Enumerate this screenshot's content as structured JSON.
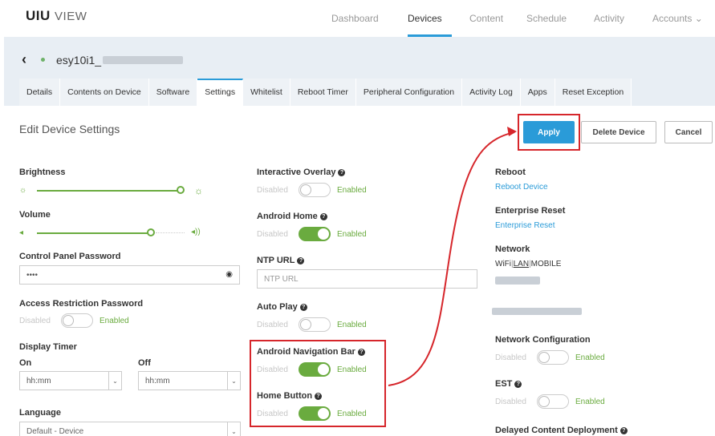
{
  "app": {
    "logo_bold": "UIU",
    "logo_light": "VIEW"
  },
  "nav": [
    {
      "label": "Dashboard",
      "active": false
    },
    {
      "label": "Devices",
      "active": true
    },
    {
      "label": "Content",
      "active": false
    },
    {
      "label": "Schedule",
      "active": false
    },
    {
      "label": "Activity",
      "active": false
    },
    {
      "label": "Accounts ⌄",
      "active": false
    }
  ],
  "device": {
    "name": "esy10i1_"
  },
  "tabs": [
    {
      "label": "Details"
    },
    {
      "label": "Contents on Device"
    },
    {
      "label": "Software"
    },
    {
      "label": "Settings"
    },
    {
      "label": "Whitelist"
    },
    {
      "label": "Reboot Timer"
    },
    {
      "label": "Peripheral Configuration"
    },
    {
      "label": "Activity Log"
    },
    {
      "label": "Apps"
    },
    {
      "label": "Reset Exception"
    }
  ],
  "page": {
    "title": "Edit Device Settings"
  },
  "buttons": {
    "apply": "Apply",
    "delete": "Delete Device",
    "cancel": "Cancel"
  },
  "toggle_labels": {
    "disabled": "Disabled",
    "enabled": "Enabled"
  },
  "left": {
    "brightness": {
      "label": "Brightness",
      "value_fraction": 1.0
    },
    "volume": {
      "label": "Volume",
      "value_fraction": 0.75
    },
    "control_panel_password": {
      "label": "Control Panel Password",
      "value": "••••"
    },
    "access_restriction_password": {
      "label": "Access Restriction Password",
      "enabled": false
    },
    "display_timer": {
      "label": "Display Timer",
      "on_label": "On",
      "off_label": "Off",
      "on_value": "hh:mm",
      "off_value": "hh:mm"
    },
    "language": {
      "label": "Language",
      "value": "Default - Device"
    }
  },
  "middle": {
    "interactive_overlay": {
      "label": "Interactive Overlay",
      "enabled": false
    },
    "android_home": {
      "label": "Android Home",
      "enabled": true
    },
    "ntp_url": {
      "label": "NTP URL",
      "placeholder": "NTP URL"
    },
    "auto_play": {
      "label": "Auto Play",
      "enabled": false
    },
    "android_navigation_bar": {
      "label": "Android Navigation Bar",
      "enabled": true
    },
    "home_button": {
      "label": "Home Button",
      "enabled": true
    }
  },
  "right": {
    "reboot": {
      "label": "Reboot",
      "link": "Reboot Device"
    },
    "enterprise_reset": {
      "label": "Enterprise Reset",
      "link": "Enterprise Reset"
    },
    "network": {
      "label": "Network",
      "opt_wifi": "WiFi",
      "opt_lan": "LAN",
      "opt_mobile": "MOBILE",
      "sep": "|"
    },
    "network_configuration": {
      "label": "Network Configuration",
      "enabled": false
    },
    "est": {
      "label": "EST",
      "enabled": false
    },
    "delayed_content": {
      "label": "Delayed Content Deployment"
    }
  },
  "colors": {
    "accent": "#2a9bd8",
    "green": "#6aab3f",
    "annotation_red": "#d6262b"
  }
}
